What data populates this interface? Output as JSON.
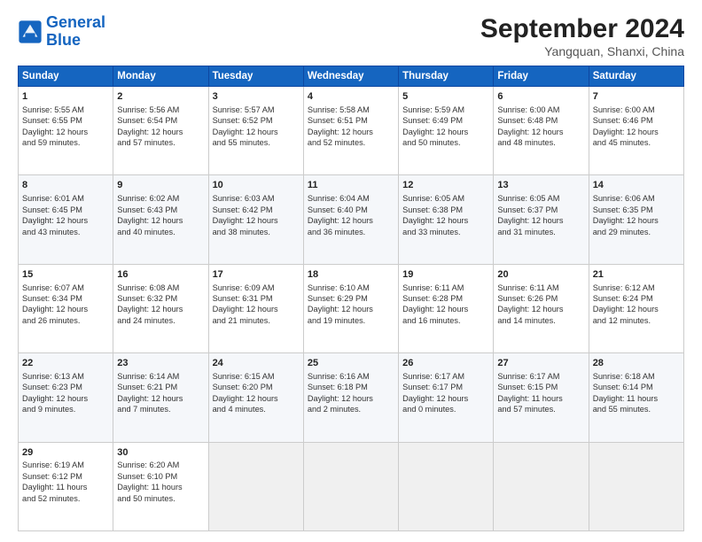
{
  "header": {
    "logo_general": "General",
    "logo_blue": "Blue",
    "title": "September 2024",
    "location": "Yangquan, Shanxi, China"
  },
  "weekdays": [
    "Sunday",
    "Monday",
    "Tuesday",
    "Wednesday",
    "Thursday",
    "Friday",
    "Saturday"
  ],
  "weeks": [
    [
      {
        "day": "1",
        "lines": [
          "Sunrise: 5:55 AM",
          "Sunset: 6:55 PM",
          "Daylight: 12 hours",
          "and 59 minutes."
        ]
      },
      {
        "day": "2",
        "lines": [
          "Sunrise: 5:56 AM",
          "Sunset: 6:54 PM",
          "Daylight: 12 hours",
          "and 57 minutes."
        ]
      },
      {
        "day": "3",
        "lines": [
          "Sunrise: 5:57 AM",
          "Sunset: 6:52 PM",
          "Daylight: 12 hours",
          "and 55 minutes."
        ]
      },
      {
        "day": "4",
        "lines": [
          "Sunrise: 5:58 AM",
          "Sunset: 6:51 PM",
          "Daylight: 12 hours",
          "and 52 minutes."
        ]
      },
      {
        "day": "5",
        "lines": [
          "Sunrise: 5:59 AM",
          "Sunset: 6:49 PM",
          "Daylight: 12 hours",
          "and 50 minutes."
        ]
      },
      {
        "day": "6",
        "lines": [
          "Sunrise: 6:00 AM",
          "Sunset: 6:48 PM",
          "Daylight: 12 hours",
          "and 48 minutes."
        ]
      },
      {
        "day": "7",
        "lines": [
          "Sunrise: 6:00 AM",
          "Sunset: 6:46 PM",
          "Daylight: 12 hours",
          "and 45 minutes."
        ]
      }
    ],
    [
      {
        "day": "8",
        "lines": [
          "Sunrise: 6:01 AM",
          "Sunset: 6:45 PM",
          "Daylight: 12 hours",
          "and 43 minutes."
        ]
      },
      {
        "day": "9",
        "lines": [
          "Sunrise: 6:02 AM",
          "Sunset: 6:43 PM",
          "Daylight: 12 hours",
          "and 40 minutes."
        ]
      },
      {
        "day": "10",
        "lines": [
          "Sunrise: 6:03 AM",
          "Sunset: 6:42 PM",
          "Daylight: 12 hours",
          "and 38 minutes."
        ]
      },
      {
        "day": "11",
        "lines": [
          "Sunrise: 6:04 AM",
          "Sunset: 6:40 PM",
          "Daylight: 12 hours",
          "and 36 minutes."
        ]
      },
      {
        "day": "12",
        "lines": [
          "Sunrise: 6:05 AM",
          "Sunset: 6:38 PM",
          "Daylight: 12 hours",
          "and 33 minutes."
        ]
      },
      {
        "day": "13",
        "lines": [
          "Sunrise: 6:05 AM",
          "Sunset: 6:37 PM",
          "Daylight: 12 hours",
          "and 31 minutes."
        ]
      },
      {
        "day": "14",
        "lines": [
          "Sunrise: 6:06 AM",
          "Sunset: 6:35 PM",
          "Daylight: 12 hours",
          "and 29 minutes."
        ]
      }
    ],
    [
      {
        "day": "15",
        "lines": [
          "Sunrise: 6:07 AM",
          "Sunset: 6:34 PM",
          "Daylight: 12 hours",
          "and 26 minutes."
        ]
      },
      {
        "day": "16",
        "lines": [
          "Sunrise: 6:08 AM",
          "Sunset: 6:32 PM",
          "Daylight: 12 hours",
          "and 24 minutes."
        ]
      },
      {
        "day": "17",
        "lines": [
          "Sunrise: 6:09 AM",
          "Sunset: 6:31 PM",
          "Daylight: 12 hours",
          "and 21 minutes."
        ]
      },
      {
        "day": "18",
        "lines": [
          "Sunrise: 6:10 AM",
          "Sunset: 6:29 PM",
          "Daylight: 12 hours",
          "and 19 minutes."
        ]
      },
      {
        "day": "19",
        "lines": [
          "Sunrise: 6:11 AM",
          "Sunset: 6:28 PM",
          "Daylight: 12 hours",
          "and 16 minutes."
        ]
      },
      {
        "day": "20",
        "lines": [
          "Sunrise: 6:11 AM",
          "Sunset: 6:26 PM",
          "Daylight: 12 hours",
          "and 14 minutes."
        ]
      },
      {
        "day": "21",
        "lines": [
          "Sunrise: 6:12 AM",
          "Sunset: 6:24 PM",
          "Daylight: 12 hours",
          "and 12 minutes."
        ]
      }
    ],
    [
      {
        "day": "22",
        "lines": [
          "Sunrise: 6:13 AM",
          "Sunset: 6:23 PM",
          "Daylight: 12 hours",
          "and 9 minutes."
        ]
      },
      {
        "day": "23",
        "lines": [
          "Sunrise: 6:14 AM",
          "Sunset: 6:21 PM",
          "Daylight: 12 hours",
          "and 7 minutes."
        ]
      },
      {
        "day": "24",
        "lines": [
          "Sunrise: 6:15 AM",
          "Sunset: 6:20 PM",
          "Daylight: 12 hours",
          "and 4 minutes."
        ]
      },
      {
        "day": "25",
        "lines": [
          "Sunrise: 6:16 AM",
          "Sunset: 6:18 PM",
          "Daylight: 12 hours",
          "and 2 minutes."
        ]
      },
      {
        "day": "26",
        "lines": [
          "Sunrise: 6:17 AM",
          "Sunset: 6:17 PM",
          "Daylight: 12 hours",
          "and 0 minutes."
        ]
      },
      {
        "day": "27",
        "lines": [
          "Sunrise: 6:17 AM",
          "Sunset: 6:15 PM",
          "Daylight: 11 hours",
          "and 57 minutes."
        ]
      },
      {
        "day": "28",
        "lines": [
          "Sunrise: 6:18 AM",
          "Sunset: 6:14 PM",
          "Daylight: 11 hours",
          "and 55 minutes."
        ]
      }
    ],
    [
      {
        "day": "29",
        "lines": [
          "Sunrise: 6:19 AM",
          "Sunset: 6:12 PM",
          "Daylight: 11 hours",
          "and 52 minutes."
        ]
      },
      {
        "day": "30",
        "lines": [
          "Sunrise: 6:20 AM",
          "Sunset: 6:10 PM",
          "Daylight: 11 hours",
          "and 50 minutes."
        ]
      },
      {
        "day": "",
        "lines": []
      },
      {
        "day": "",
        "lines": []
      },
      {
        "day": "",
        "lines": []
      },
      {
        "day": "",
        "lines": []
      },
      {
        "day": "",
        "lines": []
      }
    ]
  ]
}
